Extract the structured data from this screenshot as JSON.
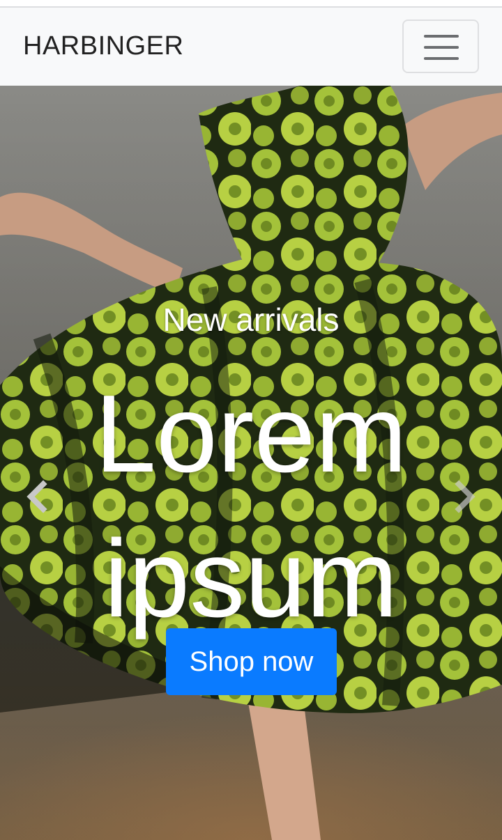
{
  "navbar": {
    "brand": "HARBINGER",
    "toggler_icon": "hamburger-menu-icon"
  },
  "hero": {
    "kicker": "New arrivals",
    "title": "Lorem ipsum",
    "cta_label": "Shop now",
    "prev_icon": "chevron-left-icon",
    "next_icon": "chevron-right-icon",
    "image": "dress-photo"
  },
  "colors": {
    "navbar_bg": "#f8f9fa",
    "cta_bg": "#0a7bff",
    "dress_green": "#a8c43a"
  }
}
